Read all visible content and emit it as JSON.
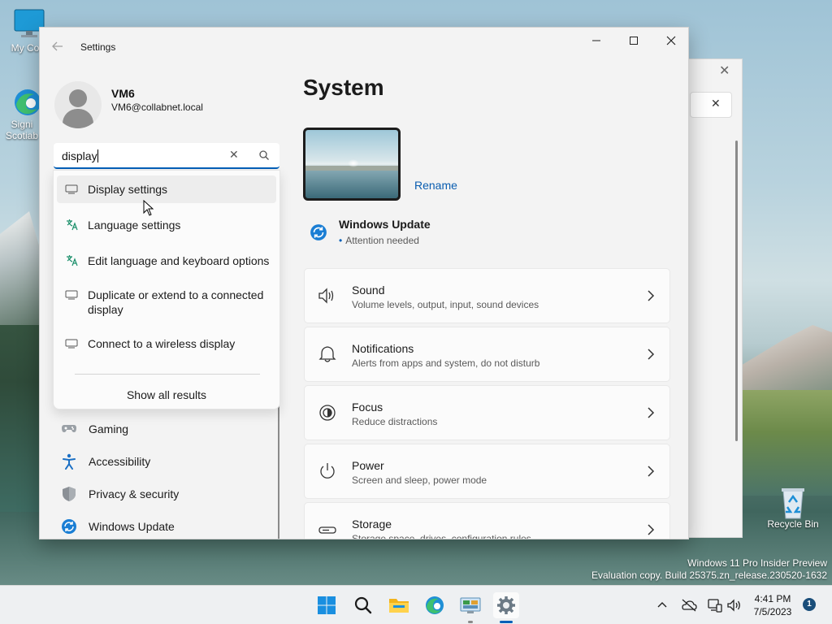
{
  "desktop": {
    "icons": [
      {
        "label": "My Com"
      },
      {
        "label": "Signi Scotiab"
      },
      {
        "label": "Recycle Bin"
      }
    ],
    "watermark_line1": "Windows 11 Pro Insider Preview",
    "watermark_line2": "Evaluation copy. Build 25375.zn_release.230520-1632"
  },
  "window": {
    "title": "Settings",
    "minimize_icon": "minimize-icon",
    "maximize_icon": "maximize-icon",
    "close_icon": "close-icon"
  },
  "user": {
    "name": "VM6",
    "email": "VM6@collabnet.local"
  },
  "search": {
    "value": "display",
    "clear_icon": "✕"
  },
  "search_results": [
    {
      "label": "Display settings",
      "icon": "monitor-icon"
    },
    {
      "label": "Language settings",
      "icon": "language-icon"
    },
    {
      "label": "Edit language and keyboard options",
      "icon": "language-icon"
    },
    {
      "label": "Duplicate or extend to a connected display",
      "icon": "monitor-icon"
    },
    {
      "label": "Connect to a wireless display",
      "icon": "monitor-icon"
    }
  ],
  "show_all": "Show all results",
  "nav": [
    {
      "label": "Gaming",
      "icon": "gamepad-icon"
    },
    {
      "label": "Accessibility",
      "icon": "accessibility-icon"
    },
    {
      "label": "Privacy & security",
      "icon": "shield-icon"
    },
    {
      "label": "Windows Update",
      "icon": "update-icon"
    }
  ],
  "main": {
    "title": "System",
    "rename": "Rename",
    "windows_update": {
      "title": "Windows Update",
      "status": "Attention needed"
    },
    "cards": [
      {
        "title": "Sound",
        "subtitle": "Volume levels, output, input, sound devices",
        "icon": "speaker-icon"
      },
      {
        "title": "Notifications",
        "subtitle": "Alerts from apps and system, do not disturb",
        "icon": "bell-icon"
      },
      {
        "title": "Focus",
        "subtitle": "Reduce distractions",
        "icon": "focus-icon"
      },
      {
        "title": "Power",
        "subtitle": "Screen and sleep, power mode",
        "icon": "power-icon"
      },
      {
        "title": "Storage",
        "subtitle": "Storage space, drives, configuration rules",
        "icon": "storage-icon"
      }
    ]
  },
  "taskbar": {
    "apps": [
      "start-icon",
      "search-icon",
      "file-explorer-icon",
      "edge-icon",
      "control-panel-icon",
      "settings-icon"
    ],
    "time": "4:41 PM",
    "date": "7/5/2023",
    "notification_count": "1"
  },
  "colors": {
    "accent": "#005fb8",
    "link": "#0a5db0",
    "window_bg": "#f3f3f3",
    "card_bg": "#fbfbfb",
    "taskbar_bg": "#eef0f2"
  }
}
